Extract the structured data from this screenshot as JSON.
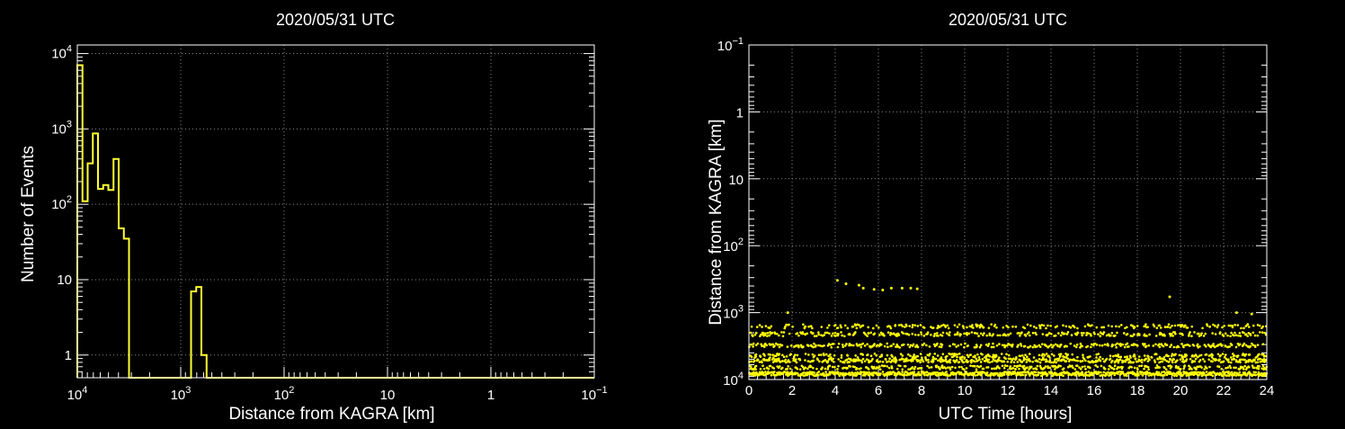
{
  "chart_data": [
    {
      "type": "step-histogram",
      "title": "2020/05/31 UTC",
      "xlabel": "Distance from KAGRA [km]",
      "ylabel": "Number of Events",
      "x_scale": "log",
      "x_reversed": true,
      "xlim": [
        10000,
        0.1
      ],
      "y_scale": "log",
      "ylim": [
        0.5,
        13000
      ],
      "x_ticks": [
        {
          "v": 10000,
          "base": "10",
          "exp": "4"
        },
        {
          "v": 1000,
          "base": "10",
          "exp": "3"
        },
        {
          "v": 100,
          "base": "10",
          "exp": "2"
        },
        {
          "v": 10,
          "base": "10",
          "exp": ""
        },
        {
          "v": 1,
          "base": "1",
          "exp": ""
        },
        {
          "v": 0.1,
          "base": "10",
          "exp": "−1"
        }
      ],
      "y_ticks": [
        {
          "v": 1,
          "base": "1",
          "exp": ""
        },
        {
          "v": 10,
          "base": "10",
          "exp": ""
        },
        {
          "v": 100,
          "base": "10",
          "exp": "2"
        },
        {
          "v": 1000,
          "base": "10",
          "exp": "3"
        },
        {
          "v": 10000,
          "base": "10",
          "exp": "4"
        }
      ],
      "grid": true,
      "color": "#ffff33",
      "bin_edges": [
        10000,
        8913,
        7943,
        7079,
        6310,
        5623,
        5012,
        4467,
        3981,
        3548,
        3162,
        2818,
        2512,
        2239,
        1995,
        1778,
        1585,
        1413,
        1259,
        1122,
        1000,
        891,
        794,
        708,
        631,
        562,
        501,
        447,
        398,
        355,
        316
      ],
      "counts": [
        7000,
        110,
        350,
        870,
        160,
        180,
        155,
        400,
        48,
        35,
        0,
        0,
        0,
        0,
        0,
        0,
        0,
        0,
        0,
        0,
        0,
        0,
        7,
        8,
        1,
        0,
        0,
        0,
        0,
        0
      ]
    },
    {
      "type": "scatter",
      "title": "2020/05/31 UTC",
      "xlabel": "UTC Time [hours]",
      "ylabel": "Distance from KAGRA [km]",
      "xlim": [
        0,
        24
      ],
      "x_ticks": [
        0,
        2,
        4,
        6,
        8,
        10,
        12,
        14,
        16,
        18,
        20,
        22,
        24
      ],
      "y_scale": "log",
      "y_reversed": true,
      "ylim": [
        10000,
        0.1
      ],
      "y_ticks": [
        {
          "v": 0.1,
          "base": "10",
          "exp": "−1"
        },
        {
          "v": 1,
          "base": "1",
          "exp": ""
        },
        {
          "v": 10,
          "base": "10",
          "exp": ""
        },
        {
          "v": 100,
          "base": "10",
          "exp": "2"
        },
        {
          "v": 1000,
          "base": "10",
          "exp": "3"
        },
        {
          "v": 10000,
          "base": "10",
          "exp": "4"
        }
      ],
      "grid": true,
      "color": "#ffff00",
      "bands_km": [
        8200,
        6600,
        5200,
        4400,
        3100,
        2100,
        1600
      ],
      "band_density": [
        0.95,
        0.4,
        0.55,
        0.3,
        0.4,
        0.35,
        0.28
      ],
      "isolated_points": [
        {
          "t": 4.1,
          "d": 330
        },
        {
          "t": 4.5,
          "d": 370
        },
        {
          "t": 5.1,
          "d": 390
        },
        {
          "t": 5.3,
          "d": 430
        },
        {
          "t": 5.8,
          "d": 450
        },
        {
          "t": 6.2,
          "d": 460
        },
        {
          "t": 6.6,
          "d": 430
        },
        {
          "t": 7.1,
          "d": 430
        },
        {
          "t": 7.5,
          "d": 430
        },
        {
          "t": 7.8,
          "d": 440
        },
        {
          "t": 19.5,
          "d": 580
        },
        {
          "t": 1.8,
          "d": 1000
        },
        {
          "t": 22.6,
          "d": 1000
        },
        {
          "t": 23.3,
          "d": 1050
        }
      ]
    }
  ]
}
